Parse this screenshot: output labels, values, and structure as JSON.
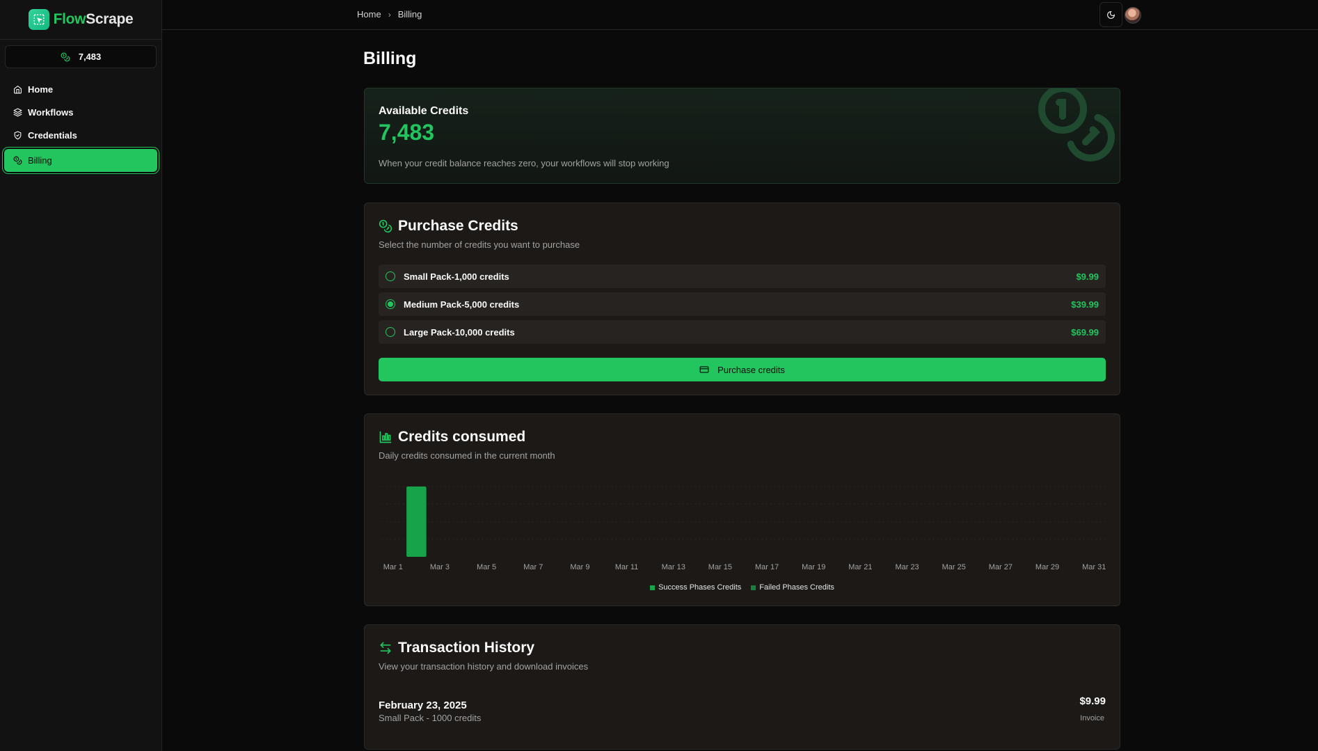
{
  "brand": {
    "part1": "Flow",
    "part2": "Scrape"
  },
  "sidebar": {
    "credits": "7,483",
    "items": [
      {
        "label": "Home",
        "icon": "home-icon"
      },
      {
        "label": "Workflows",
        "icon": "layers-icon"
      },
      {
        "label": "Credentials",
        "icon": "shield-check-icon"
      },
      {
        "label": "Billing",
        "icon": "coins-icon",
        "active": true
      }
    ]
  },
  "header": {
    "breadcrumb": [
      "Home",
      "Billing"
    ]
  },
  "page": {
    "title": "Billing"
  },
  "available": {
    "label": "Available Credits",
    "value": "7,483",
    "description": "When your credit balance reaches zero, your workflows will stop working"
  },
  "purchase": {
    "title": "Purchase Credits",
    "subtitle": "Select the number of credits you want to purchase",
    "packs": [
      {
        "label": "Small Pack-1,000 credits",
        "price": "$9.99",
        "selected": false
      },
      {
        "label": "Medium Pack-5,000 credits",
        "price": "$39.99",
        "selected": true
      },
      {
        "label": "Large Pack-10,000 credits",
        "price": "$69.99",
        "selected": false
      }
    ],
    "button_label": "Purchase credits"
  },
  "consumed": {
    "title": "Credits consumed",
    "subtitle": "Daily credits consumed in the current month"
  },
  "chart_data": {
    "type": "bar",
    "stacked": true,
    "categories": [
      "Mar 1",
      "Mar 2",
      "Mar 3",
      "Mar 4",
      "Mar 5",
      "Mar 6",
      "Mar 7",
      "Mar 8",
      "Mar 9",
      "Mar 10",
      "Mar 11",
      "Mar 12",
      "Mar 13",
      "Mar 14",
      "Mar 15",
      "Mar 16",
      "Mar 17",
      "Mar 18",
      "Mar 19",
      "Mar 20",
      "Mar 21",
      "Mar 22",
      "Mar 23",
      "Mar 24",
      "Mar 25",
      "Mar 26",
      "Mar 27",
      "Mar 28",
      "Mar 29",
      "Mar 30",
      "Mar 31"
    ],
    "tick_labels": [
      "Mar 1",
      "Mar 3",
      "Mar 5",
      "Mar 7",
      "Mar 9",
      "Mar 11",
      "Mar 13",
      "Mar 15",
      "Mar 17",
      "Mar 19",
      "Mar 21",
      "Mar 23",
      "Mar 25",
      "Mar 27",
      "Mar 29",
      "Mar 31"
    ],
    "series": [
      {
        "name": "Success Phases Credits",
        "color": "#16a34a",
        "values": [
          0,
          1,
          0,
          0,
          0,
          0,
          0,
          0,
          0,
          0,
          0,
          0,
          0,
          0,
          0,
          0,
          0,
          0,
          0,
          0,
          0,
          0,
          0,
          0,
          0,
          0,
          0,
          0,
          0,
          0,
          0
        ]
      },
      {
        "name": "Failed Phases Credits",
        "color": "#15803d",
        "values": [
          0,
          0,
          0,
          0,
          0,
          0,
          0,
          0,
          0,
          0,
          0,
          0,
          0,
          0,
          0,
          0,
          0,
          0,
          0,
          0,
          0,
          0,
          0,
          0,
          0,
          0,
          0,
          0,
          0,
          0,
          0
        ]
      }
    ],
    "ylim": [
      0,
      1
    ],
    "grid": true,
    "legend": "bottom-center"
  },
  "transactions": {
    "title": "Transaction History",
    "subtitle": "View your transaction history and download invoices",
    "items": [
      {
        "date": "February 23, 2025",
        "description": "Small Pack - 1000 credits",
        "amount": "$9.99",
        "action": "Invoice"
      }
    ]
  }
}
